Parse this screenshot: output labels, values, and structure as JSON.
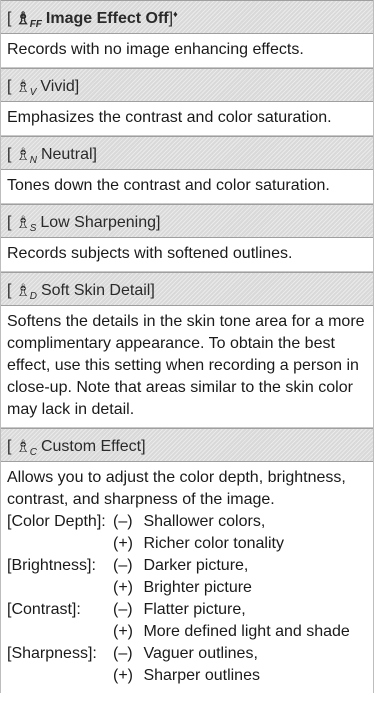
{
  "sections": [
    {
      "icon_char": "♗",
      "icon_sub": "FF",
      "label": "Image Effect Off",
      "marker": "♦",
      "bold": true,
      "description": "Records with no image enhancing effects."
    },
    {
      "icon_char": "♗",
      "icon_sub": "V",
      "label": "Vivid",
      "marker": "",
      "bold": false,
      "description": "Emphasizes the contrast and color saturation."
    },
    {
      "icon_char": "♗",
      "icon_sub": "N",
      "label": "Neutral",
      "marker": "",
      "bold": false,
      "description": "Tones down the contrast and color saturation."
    },
    {
      "icon_char": "♗",
      "icon_sub": "S",
      "label": "Low Sharpening",
      "marker": "",
      "bold": false,
      "description": "Records subjects with softened outlines."
    },
    {
      "icon_char": "♗",
      "icon_sub": "D",
      "label": "Soft Skin Detail",
      "marker": "",
      "bold": false,
      "description": "Softens the details in the skin tone area for a more complimentary appearance. To obtain the best effect, use this setting when recording a person in close-up. Note that areas similar to the skin color may lack in detail."
    },
    {
      "icon_char": "♗",
      "icon_sub": "C",
      "label": "Custom Effect",
      "marker": "",
      "bold": false,
      "description": "Allows you to adjust the color depth, brightness, contrast, and sharpness of the image."
    }
  ],
  "settings": [
    {
      "key": "[Color Depth]:",
      "minus_mark": "(–)",
      "minus": "Shallower colors,",
      "plus_mark": "(+)",
      "plus": "Richer color tonality"
    },
    {
      "key": "[Brightness]:",
      "minus_mark": "(–)",
      "minus": "Darker picture,",
      "plus_mark": "(+)",
      "plus": "Brighter picture"
    },
    {
      "key": "[Contrast]:",
      "minus_mark": "(–)",
      "minus": "Flatter picture,",
      "plus_mark": "(+)",
      "plus": "More defined light and shade"
    },
    {
      "key": "[Sharpness]:",
      "minus_mark": "(–)",
      "minus": "Vaguer outlines,",
      "plus_mark": "(+)",
      "plus": "Sharper outlines"
    }
  ],
  "brackets": {
    "open": "[",
    "close": "]"
  }
}
